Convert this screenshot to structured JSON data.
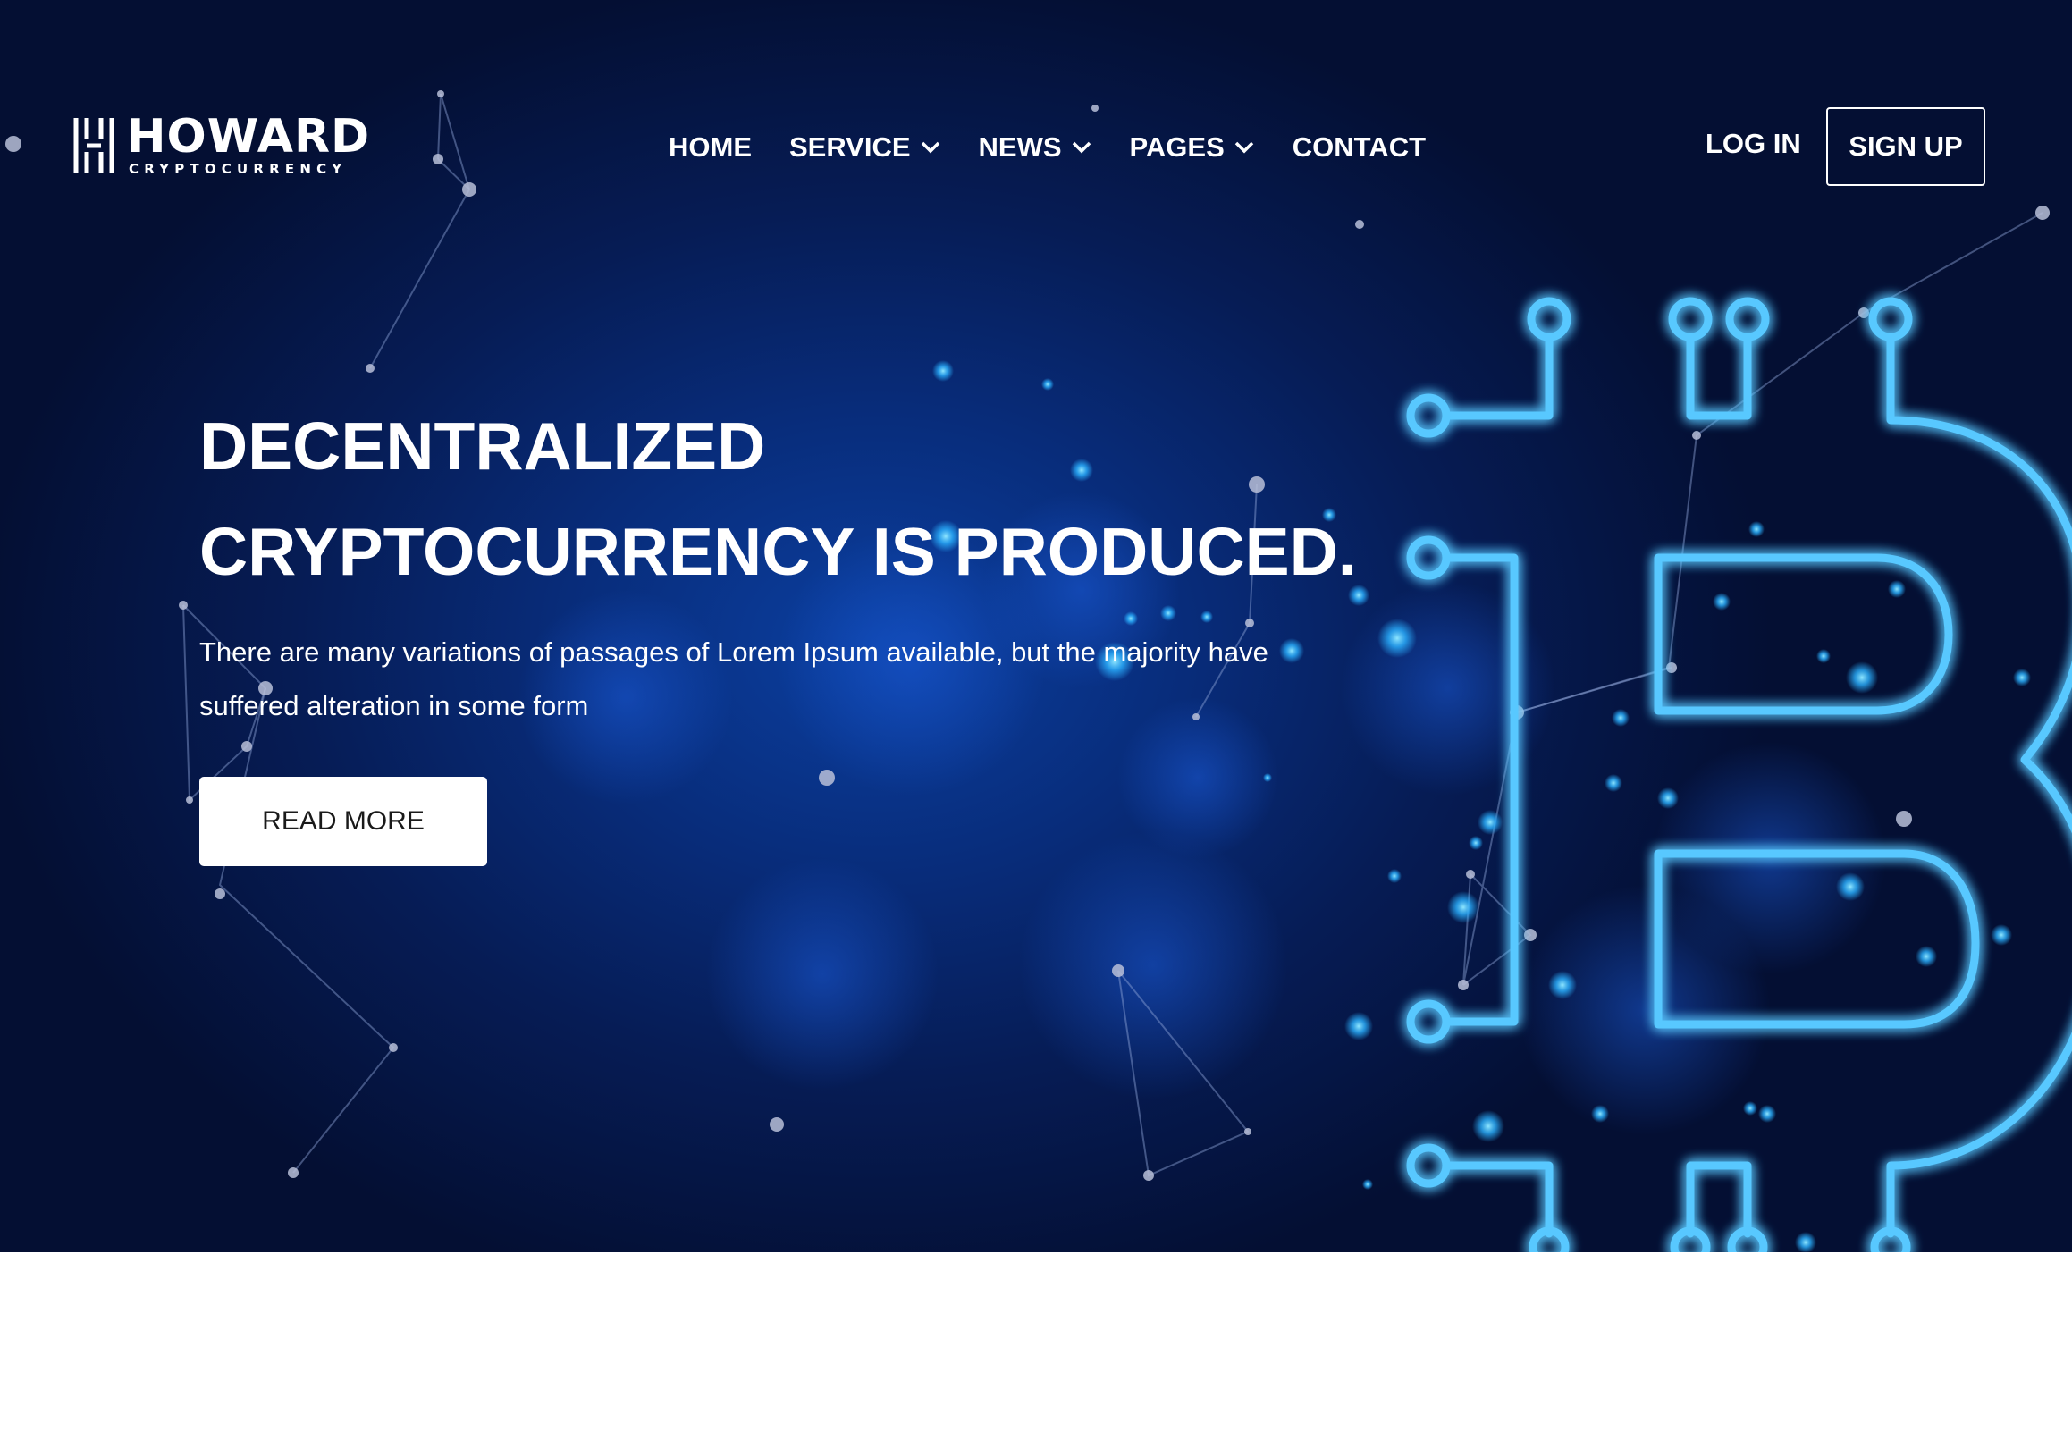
{
  "brand": {
    "name": "HOWARD",
    "tagline": "CRYPTOCURRENCY"
  },
  "nav": {
    "items": [
      {
        "label": "HOME",
        "dropdown": false
      },
      {
        "label": "SERVICE",
        "dropdown": true
      },
      {
        "label": "NEWS",
        "dropdown": true
      },
      {
        "label": "PAGES",
        "dropdown": true
      },
      {
        "label": "CONTACT",
        "dropdown": false
      }
    ],
    "login_label": "LOG IN",
    "signup_label": "SIGN UP"
  },
  "hero": {
    "headline_line1": "DECENTRALIZED",
    "headline_line2": "CRYPTOCURRENCY IS PRODUCED.",
    "subtext": "There are many variations of passages of Lorem Ipsum available, but the majority have suffered alteration in some form",
    "cta_label": "READ MORE",
    "graphic": "bitcoin-circuit-icon"
  },
  "colors": {
    "hero_dark": "#040f33",
    "hero_mid": "#082c7a",
    "glow": "#3fb8ff",
    "text": "#ffffff"
  }
}
